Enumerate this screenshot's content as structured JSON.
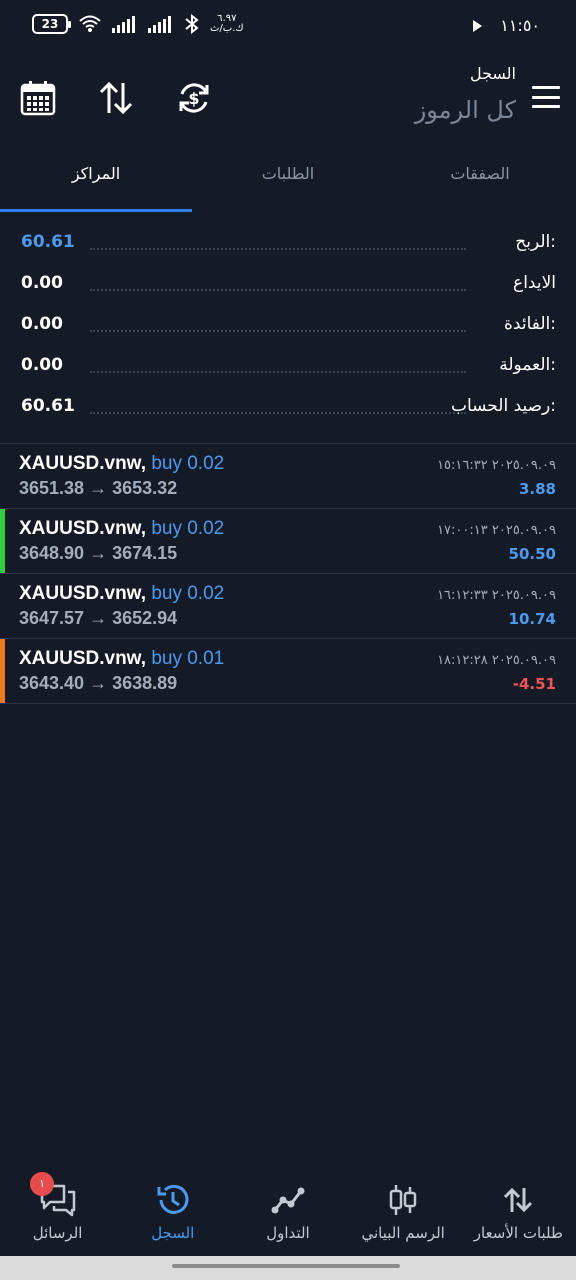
{
  "status": {
    "battery": "23",
    "net_speed_top": "٦.٩٧",
    "net_speed_bottom": "ك.ب/ث",
    "time": "١١:٥٠"
  },
  "header": {
    "title": "السجل",
    "subtitle": "كل الرموز"
  },
  "tabs": [
    {
      "label": "الصفقات"
    },
    {
      "label": "الطلبات"
    },
    {
      "label": "المراكز"
    }
  ],
  "summary": [
    {
      "label": "الربح:",
      "value": "60.61"
    },
    {
      "label": "الايداع",
      "value": "0.00"
    },
    {
      "label": "الفائدة:",
      "value": "0.00"
    },
    {
      "label": "العمولة:",
      "value": "0.00"
    },
    {
      "label": "رصيد الحساب:",
      "value": "60.61"
    }
  ],
  "deals": [
    {
      "symbol": "XAUUSD.vnw,",
      "side": "buy 0.02",
      "prices": "3651.38 → 3653.32",
      "time": "٢٠٢٥.٠٩.٠٩ ١٥:١٦:٣٢",
      "profit": "3.88",
      "bar_color": ""
    },
    {
      "symbol": "XAUUSD.vnw,",
      "side": "buy 0.02",
      "prices": "3648.90 → 3674.15",
      "time": "٢٠٢٥.٠٩.٠٩ ١٧:٠٠:١٣",
      "profit": "50.50",
      "bar_color": "#2ecc40"
    },
    {
      "symbol": "XAUUSD.vnw,",
      "side": "buy 0.02",
      "prices": "3647.57 → 3652.94",
      "time": "٢٠٢٥.٠٩.٠٩ ١٦:١٢:٣٣",
      "profit": "10.74",
      "bar_color": ""
    },
    {
      "symbol": "XAUUSD.vnw,",
      "side": "buy 0.01",
      "prices": "3643.40 → 3638.89",
      "time": "٢٠٢٥.٠٩.٠٩ ١٨:١٢:٢٨",
      "profit": "-4.51",
      "bar_color": "#f07a1a"
    }
  ],
  "nav": {
    "messages": "الرسائل",
    "messages_badge": "١",
    "history": "السجل",
    "trade": "التداول",
    "chart": "الرسم البياني",
    "quotes": "طلبات الأسعار"
  },
  "colors": {
    "background": "#151b26",
    "accent": "#4a9bf0",
    "loss": "#f05454"
  }
}
